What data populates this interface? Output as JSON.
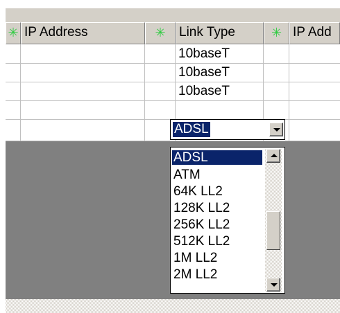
{
  "grid": {
    "header": {
      "col1_icon": "green-star-icon",
      "col2_label": "IP Address",
      "col3_icon": "green-star-icon",
      "col4_label": "Link Type",
      "col5_icon": "green-star-icon",
      "col6_label": "IP Add"
    },
    "rows": [
      {
        "link_type": "10baseT"
      },
      {
        "link_type": "10baseT"
      },
      {
        "link_type": "10baseT"
      },
      {
        "link_type": "ADSL"
      }
    ]
  },
  "dropdown": {
    "selected": "ADSL",
    "options": [
      "ADSL",
      "ATM",
      "64K LL2",
      "128K LL2",
      "256K LL2",
      "512K LL2",
      "1M LL2",
      "2M LL2"
    ]
  },
  "colors": {
    "selection": "#0a246a",
    "header_bg": "#d4d0c8",
    "empty_area": "#808080",
    "icon": "#2ecc40"
  }
}
